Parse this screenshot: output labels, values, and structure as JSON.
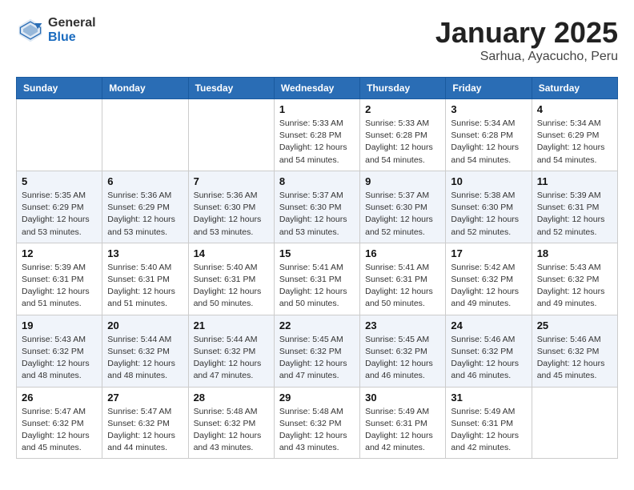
{
  "header": {
    "logo": {
      "line1": "General",
      "line2": "Blue"
    },
    "title": "January 2025",
    "subtitle": "Sarhua, Ayacucho, Peru"
  },
  "weekdays": [
    "Sunday",
    "Monday",
    "Tuesday",
    "Wednesday",
    "Thursday",
    "Friday",
    "Saturday"
  ],
  "weeks": [
    [
      {
        "day": null
      },
      {
        "day": null
      },
      {
        "day": null
      },
      {
        "day": "1",
        "sunrise": "5:33 AM",
        "sunset": "6:28 PM",
        "daylight": "12 hours and 54 minutes."
      },
      {
        "day": "2",
        "sunrise": "5:33 AM",
        "sunset": "6:28 PM",
        "daylight": "12 hours and 54 minutes."
      },
      {
        "day": "3",
        "sunrise": "5:34 AM",
        "sunset": "6:28 PM",
        "daylight": "12 hours and 54 minutes."
      },
      {
        "day": "4",
        "sunrise": "5:34 AM",
        "sunset": "6:29 PM",
        "daylight": "12 hours and 54 minutes."
      }
    ],
    [
      {
        "day": "5",
        "sunrise": "5:35 AM",
        "sunset": "6:29 PM",
        "daylight": "12 hours and 53 minutes."
      },
      {
        "day": "6",
        "sunrise": "5:36 AM",
        "sunset": "6:29 PM",
        "daylight": "12 hours and 53 minutes."
      },
      {
        "day": "7",
        "sunrise": "5:36 AM",
        "sunset": "6:30 PM",
        "daylight": "12 hours and 53 minutes."
      },
      {
        "day": "8",
        "sunrise": "5:37 AM",
        "sunset": "6:30 PM",
        "daylight": "12 hours and 53 minutes."
      },
      {
        "day": "9",
        "sunrise": "5:37 AM",
        "sunset": "6:30 PM",
        "daylight": "12 hours and 52 minutes."
      },
      {
        "day": "10",
        "sunrise": "5:38 AM",
        "sunset": "6:30 PM",
        "daylight": "12 hours and 52 minutes."
      },
      {
        "day": "11",
        "sunrise": "5:39 AM",
        "sunset": "6:31 PM",
        "daylight": "12 hours and 52 minutes."
      }
    ],
    [
      {
        "day": "12",
        "sunrise": "5:39 AM",
        "sunset": "6:31 PM",
        "daylight": "12 hours and 51 minutes."
      },
      {
        "day": "13",
        "sunrise": "5:40 AM",
        "sunset": "6:31 PM",
        "daylight": "12 hours and 51 minutes."
      },
      {
        "day": "14",
        "sunrise": "5:40 AM",
        "sunset": "6:31 PM",
        "daylight": "12 hours and 50 minutes."
      },
      {
        "day": "15",
        "sunrise": "5:41 AM",
        "sunset": "6:31 PM",
        "daylight": "12 hours and 50 minutes."
      },
      {
        "day": "16",
        "sunrise": "5:41 AM",
        "sunset": "6:31 PM",
        "daylight": "12 hours and 50 minutes."
      },
      {
        "day": "17",
        "sunrise": "5:42 AM",
        "sunset": "6:32 PM",
        "daylight": "12 hours and 49 minutes."
      },
      {
        "day": "18",
        "sunrise": "5:43 AM",
        "sunset": "6:32 PM",
        "daylight": "12 hours and 49 minutes."
      }
    ],
    [
      {
        "day": "19",
        "sunrise": "5:43 AM",
        "sunset": "6:32 PM",
        "daylight": "12 hours and 48 minutes."
      },
      {
        "day": "20",
        "sunrise": "5:44 AM",
        "sunset": "6:32 PM",
        "daylight": "12 hours and 48 minutes."
      },
      {
        "day": "21",
        "sunrise": "5:44 AM",
        "sunset": "6:32 PM",
        "daylight": "12 hours and 47 minutes."
      },
      {
        "day": "22",
        "sunrise": "5:45 AM",
        "sunset": "6:32 PM",
        "daylight": "12 hours and 47 minutes."
      },
      {
        "day": "23",
        "sunrise": "5:45 AM",
        "sunset": "6:32 PM",
        "daylight": "12 hours and 46 minutes."
      },
      {
        "day": "24",
        "sunrise": "5:46 AM",
        "sunset": "6:32 PM",
        "daylight": "12 hours and 46 minutes."
      },
      {
        "day": "25",
        "sunrise": "5:46 AM",
        "sunset": "6:32 PM",
        "daylight": "12 hours and 45 minutes."
      }
    ],
    [
      {
        "day": "26",
        "sunrise": "5:47 AM",
        "sunset": "6:32 PM",
        "daylight": "12 hours and 45 minutes."
      },
      {
        "day": "27",
        "sunrise": "5:47 AM",
        "sunset": "6:32 PM",
        "daylight": "12 hours and 44 minutes."
      },
      {
        "day": "28",
        "sunrise": "5:48 AM",
        "sunset": "6:32 PM",
        "daylight": "12 hours and 43 minutes."
      },
      {
        "day": "29",
        "sunrise": "5:48 AM",
        "sunset": "6:32 PM",
        "daylight": "12 hours and 43 minutes."
      },
      {
        "day": "30",
        "sunrise": "5:49 AM",
        "sunset": "6:31 PM",
        "daylight": "12 hours and 42 minutes."
      },
      {
        "day": "31",
        "sunrise": "5:49 AM",
        "sunset": "6:31 PM",
        "daylight": "12 hours and 42 minutes."
      },
      {
        "day": null
      }
    ]
  ],
  "labels": {
    "sunrise_prefix": "Sunrise: ",
    "sunset_prefix": "Sunset: ",
    "daylight_prefix": "Daylight: "
  }
}
